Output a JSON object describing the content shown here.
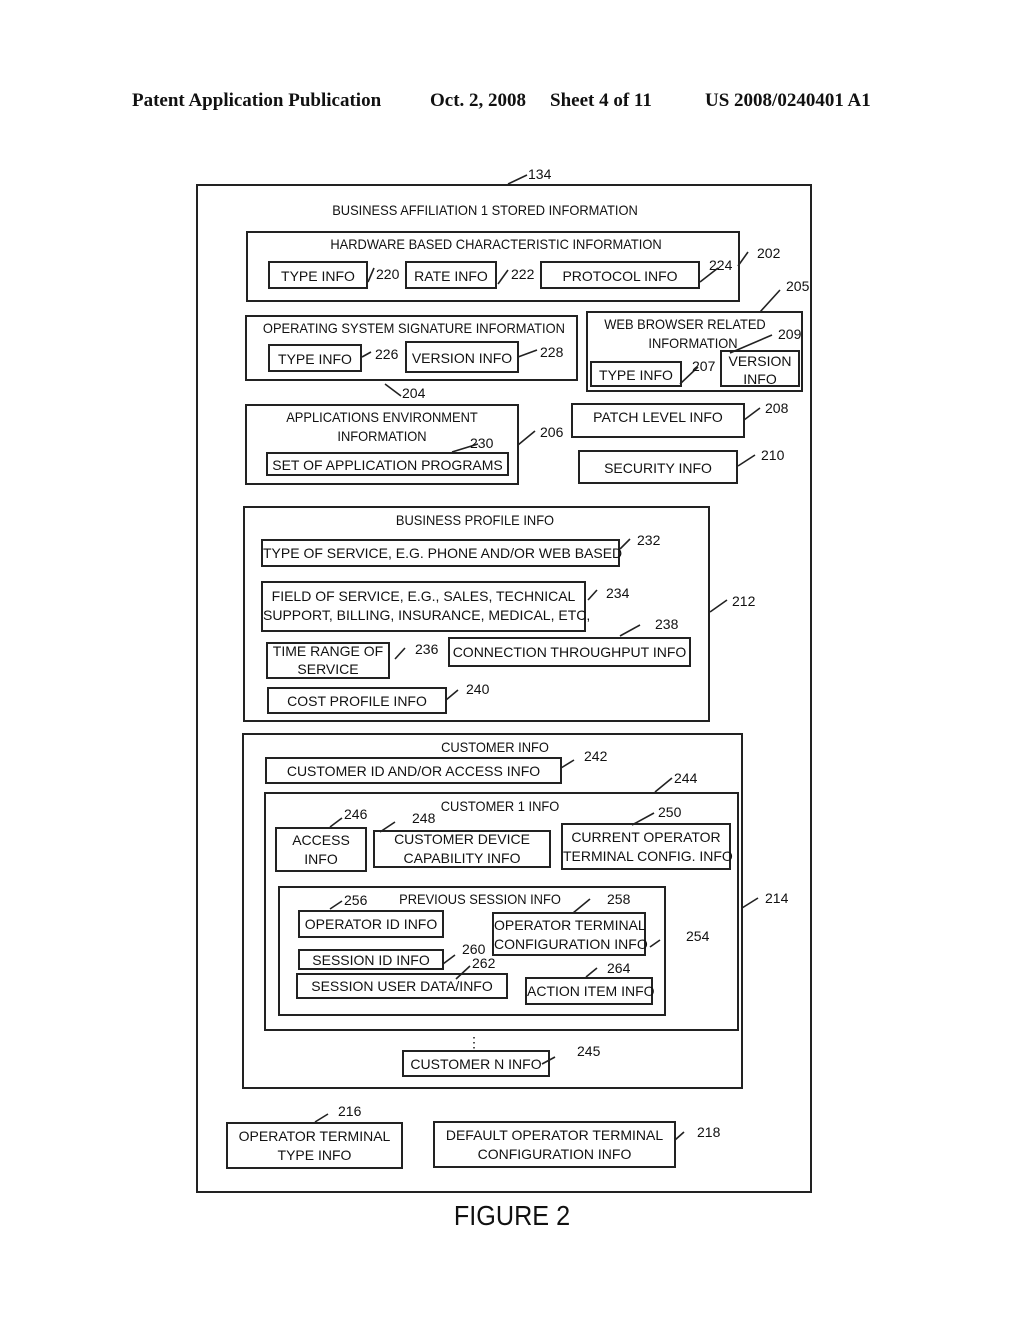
{
  "header": {
    "left": "Patent Application Publication",
    "date": "Oct. 2, 2008",
    "sheet": "Sheet 4 of 11",
    "number": "US 2008/0240401 A1"
  },
  "figure_label": "FIGURE 2",
  "outer": {
    "ref": "134",
    "title": "BUSINESS AFFILIATION 1 STORED INFORMATION"
  },
  "hardware": {
    "ref": "202",
    "title": "HARDWARE BASED CHARACTERISTIC INFORMATION",
    "items": [
      {
        "label": "TYPE INFO",
        "ref": "220"
      },
      {
        "label": "RATE INFO",
        "ref": "222"
      },
      {
        "label": "PROTOCOL INFO",
        "ref": "224"
      }
    ]
  },
  "os": {
    "ref": "204",
    "title": "OPERATING SYSTEM SIGNATURE INFORMATION",
    "items": [
      {
        "label": "TYPE INFO",
        "ref": "226"
      },
      {
        "label": "VERSION INFO",
        "ref": "228"
      }
    ]
  },
  "browser": {
    "ref": "205",
    "title_line1": "WEB BROWSER RELATED",
    "title_line2": "INFORMATION",
    "items": [
      {
        "label": "TYPE INFO",
        "ref": "207"
      },
      {
        "label_line1": "VERSION",
        "label_line2": "INFO",
        "ref": "209"
      }
    ]
  },
  "apps": {
    "ref": "206",
    "title_line1": "APPLICATIONS ENVIRONMENT",
    "title_line2": "INFORMATION",
    "item": {
      "label": "SET OF APPLICATION PROGRAMS",
      "ref": "230"
    }
  },
  "patch": {
    "label": "PATCH LEVEL INFO",
    "ref": "208"
  },
  "security": {
    "label": "SECURITY INFO",
    "ref": "210"
  },
  "business_profile": {
    "ref": "212",
    "title": "BUSINESS PROFILE INFO",
    "type_of_service": {
      "label": "TYPE OF SERVICE, E.G. PHONE AND/OR WEB BASED",
      "ref": "232"
    },
    "field_of_service": {
      "line1": "FIELD OF SERVICE, E.G., SALES, TECHNICAL",
      "line2": "SUPPORT, BILLING, INSURANCE, MEDICAL, ETC,",
      "ref": "234"
    },
    "time_range": {
      "line1": "TIME RANGE OF",
      "line2": "SERVICE",
      "ref": "236"
    },
    "throughput": {
      "label": "CONNECTION THROUGHPUT INFO",
      "ref": "238"
    },
    "cost": {
      "label": "COST PROFILE INFO",
      "ref": "240"
    }
  },
  "customer_info": {
    "ref": "214",
    "title": "CUSTOMER INFO",
    "id_access": {
      "label": "CUSTOMER ID AND/OR ACCESS INFO",
      "ref": "242"
    },
    "customer1": {
      "ref": "244",
      "title": "CUSTOMER 1 INFO",
      "access": {
        "line1": "ACCESS",
        "line2": "INFO",
        "ref": "246"
      },
      "device": {
        "line1": "CUSTOMER DEVICE",
        "line2": "CAPABILITY INFO",
        "ref": "248"
      },
      "current_terminal": {
        "line1": "CURRENT OPERATOR",
        "line2": "TERMINAL CONFIG. INFO",
        "ref": "250"
      },
      "previous_session": {
        "ref": "254",
        "title": "PREVIOUS SESSION INFO",
        "operator_id": {
          "label": "OPERATOR ID INFO",
          "ref": "256"
        },
        "operator_terminal": {
          "line1": "OPERATOR TERMINAL",
          "line2": "CONFIGURATION INFO",
          "ref": "258"
        },
        "session_id": {
          "label": "SESSION ID INFO",
          "ref": "260"
        },
        "session_user": {
          "label": "SESSION USER DATA/INFO",
          "ref": "262"
        },
        "action_item": {
          "label": "ACTION ITEM INFO",
          "ref": "264"
        }
      }
    },
    "ellipsis": "⋮",
    "customerN": {
      "label": "CUSTOMER N INFO",
      "ref": "245"
    }
  },
  "operator_terminal_type": {
    "line1": "OPERATOR TERMINAL",
    "line2": "TYPE INFO",
    "ref": "216"
  },
  "default_terminal_config": {
    "line1": "DEFAULT OPERATOR TERMINAL",
    "line2": "CONFIGURATION  INFO",
    "ref": "218"
  }
}
